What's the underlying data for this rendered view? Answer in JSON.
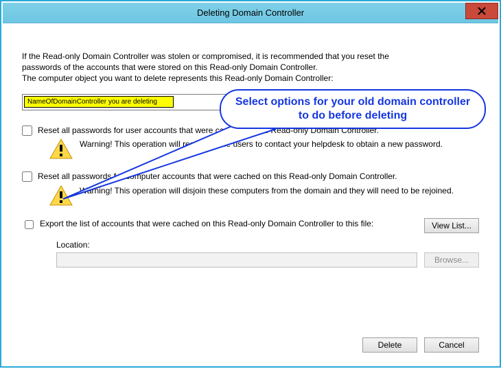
{
  "window": {
    "title": "Deleting Domain Controller"
  },
  "intro": {
    "line1": "If the Read-only Domain Controller was stolen or compromised, it is recommended that you reset the",
    "line2": "passwords of the accounts that were stored on this Read-only Domain Controller.",
    "line3": "The computer object you want to delete represents this Read-only Domain Controller:"
  },
  "dc_name": "NameOfDomainController you are deleting",
  "options": {
    "reset_user": {
      "label": "Reset all passwords for user accounts that were cached on this Read-only Domain Controller.",
      "warning": "Warning! This operation will require these users to contact your helpdesk to obtain a new password."
    },
    "reset_computer": {
      "label": "Reset all passwords for computer accounts that were cached on this Read-only Domain Controller.",
      "warning": "Warning! This operation will disjoin these computers from the domain and they will need to be rejoined."
    },
    "export": {
      "label": "Export the list of accounts that were cached on this Read-only Domain Controller to this file:",
      "view_list": "View List...",
      "location_label": "Location:",
      "location_value": "",
      "browse": "Browse..."
    }
  },
  "buttons": {
    "delete": "Delete",
    "cancel": "Cancel"
  },
  "annotation": {
    "text": "Select options for your old domain controller to do before deleting"
  }
}
